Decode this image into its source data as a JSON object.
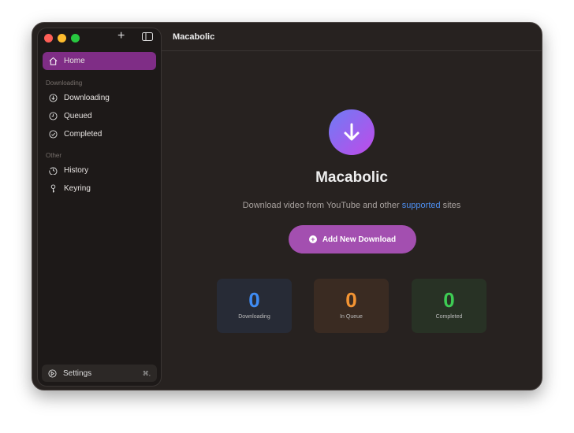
{
  "window": {
    "title": "Macabolic"
  },
  "sidebar": {
    "home": "Home",
    "section_downloading": "Downloading",
    "items_downloading": [
      {
        "label": "Downloading"
      },
      {
        "label": "Queued"
      },
      {
        "label": "Completed"
      }
    ],
    "section_other": "Other",
    "items_other": [
      {
        "label": "History"
      },
      {
        "label": "Keyring"
      }
    ],
    "settings": "Settings",
    "settings_shortcut": "⌘,"
  },
  "main": {
    "app_name": "Macabolic",
    "subtitle_pre": "Download video from YouTube and other ",
    "subtitle_link": "supported",
    "subtitle_post": " sites",
    "add_button": "Add New Download",
    "stats": [
      {
        "value": "0",
        "label": "Downloading",
        "color": "#3f8cf4"
      },
      {
        "value": "0",
        "label": "In Queue",
        "color": "#f39433"
      },
      {
        "value": "0",
        "label": "Completed",
        "color": "#3ecc54"
      }
    ]
  }
}
